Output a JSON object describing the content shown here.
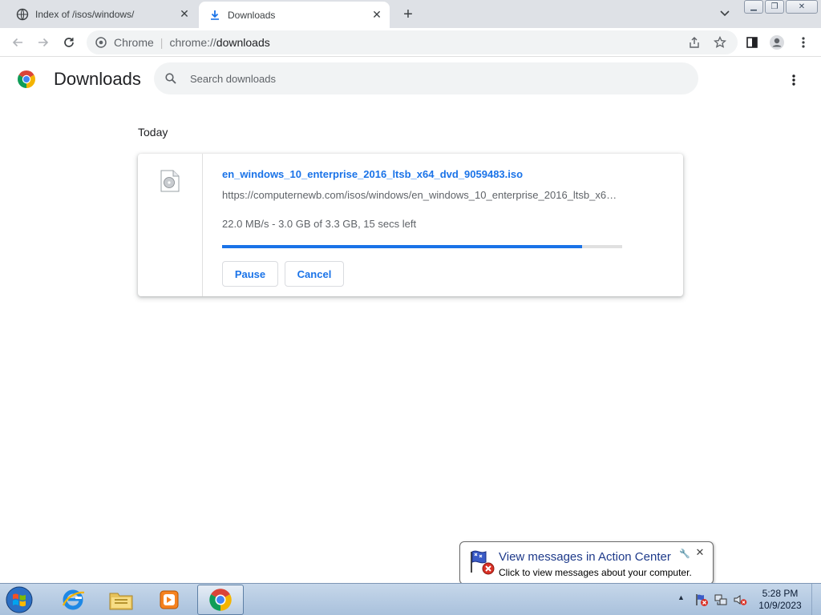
{
  "tabs": [
    {
      "title": "Index of /isos/windows/",
      "icon": "globe-icon",
      "active": false
    },
    {
      "title": "Downloads",
      "icon": "download-icon",
      "active": true
    }
  ],
  "toolbar": {
    "site_name": "Chrome",
    "url_scheme": "chrome://",
    "url_path": "downloads"
  },
  "page": {
    "title": "Downloads",
    "search_placeholder": "Search downloads",
    "date_group": "Today"
  },
  "download": {
    "file_name": "en_windows_10_enterprise_2016_ltsb_x64_dvd_9059483.iso",
    "url": "https://computernewb.com/isos/windows/en_windows_10_enterprise_2016_ltsb_x64_dvd_9059483.iso",
    "status": "22.0 MB/s - 3.0 GB of 3.3 GB, 15 secs left",
    "progress_fraction": 0.9,
    "pause_label": "Pause",
    "cancel_label": "Cancel"
  },
  "notification": {
    "title": "View messages in Action Center",
    "body": "Click to view messages about your computer."
  },
  "taskbar": {
    "time": "5:28 PM",
    "date": "10/9/2023"
  },
  "colors": {
    "accent": "#1a73e8",
    "tabstrip": "#dee1e6",
    "taskbar": "#b8cde3"
  }
}
